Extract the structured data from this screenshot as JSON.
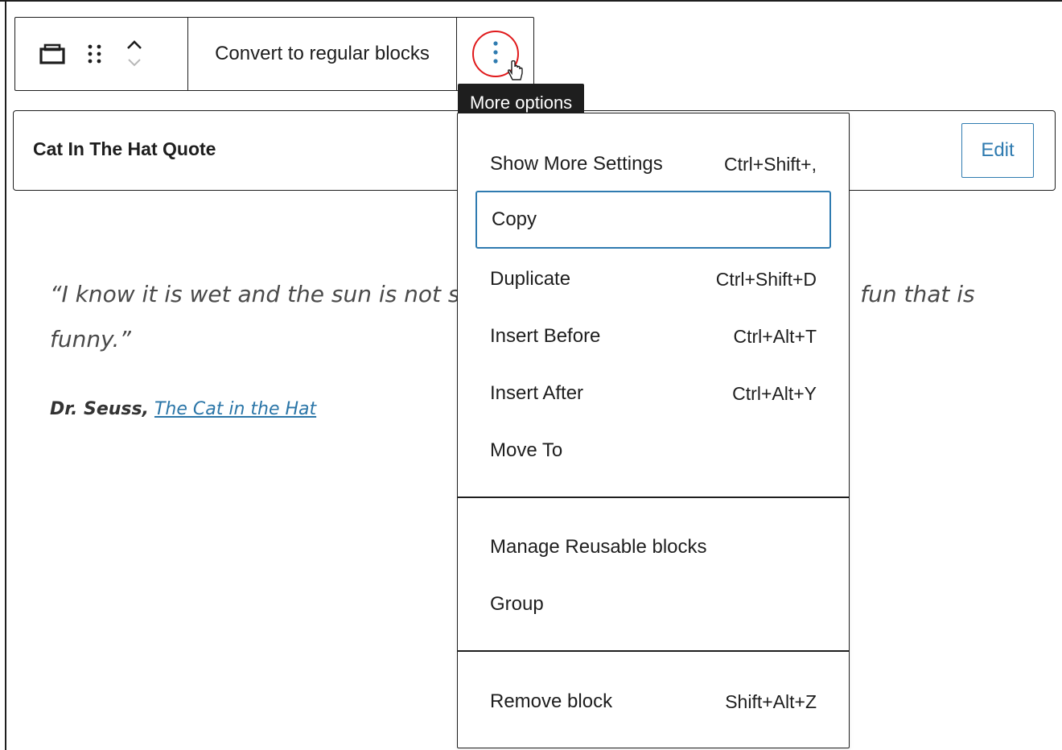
{
  "toolbar": {
    "convert_label": "Convert to regular blocks",
    "more_tooltip": "More options",
    "icons": [
      "reusable-block-icon",
      "drag-handle-icon",
      "chevron-up-icon",
      "chevron-down-icon",
      "more-vertical-icon",
      "hand-cursor-icon"
    ],
    "highlight_color": "#e0191b",
    "accent_color": "#2f7bb0"
  },
  "block": {
    "title": "Cat In The Hat Quote",
    "edit_label": "Edit"
  },
  "quote": {
    "text_left": "“I know it is wet and the sun is not su",
    "text_right": "fun that is",
    "text_line2": "funny.”",
    "author": "Dr. Seuss,",
    "work": "The Cat in the Hat"
  },
  "menu": {
    "section1": [
      {
        "label": "Show More Settings",
        "shortcut": "Ctrl+Shift+,"
      },
      {
        "label": "Copy",
        "shortcut": ""
      },
      {
        "label": "Duplicate",
        "shortcut": "Ctrl+Shift+D"
      },
      {
        "label": "Insert Before",
        "shortcut": "Ctrl+Alt+T"
      },
      {
        "label": "Insert After",
        "shortcut": "Ctrl+Alt+Y"
      },
      {
        "label": "Move To",
        "shortcut": ""
      }
    ],
    "section2": [
      {
        "label": "Manage Reusable blocks",
        "shortcut": ""
      },
      {
        "label": "Group",
        "shortcut": ""
      }
    ],
    "section3": [
      {
        "label": "Remove block",
        "shortcut": "Shift+Alt+Z"
      }
    ]
  }
}
